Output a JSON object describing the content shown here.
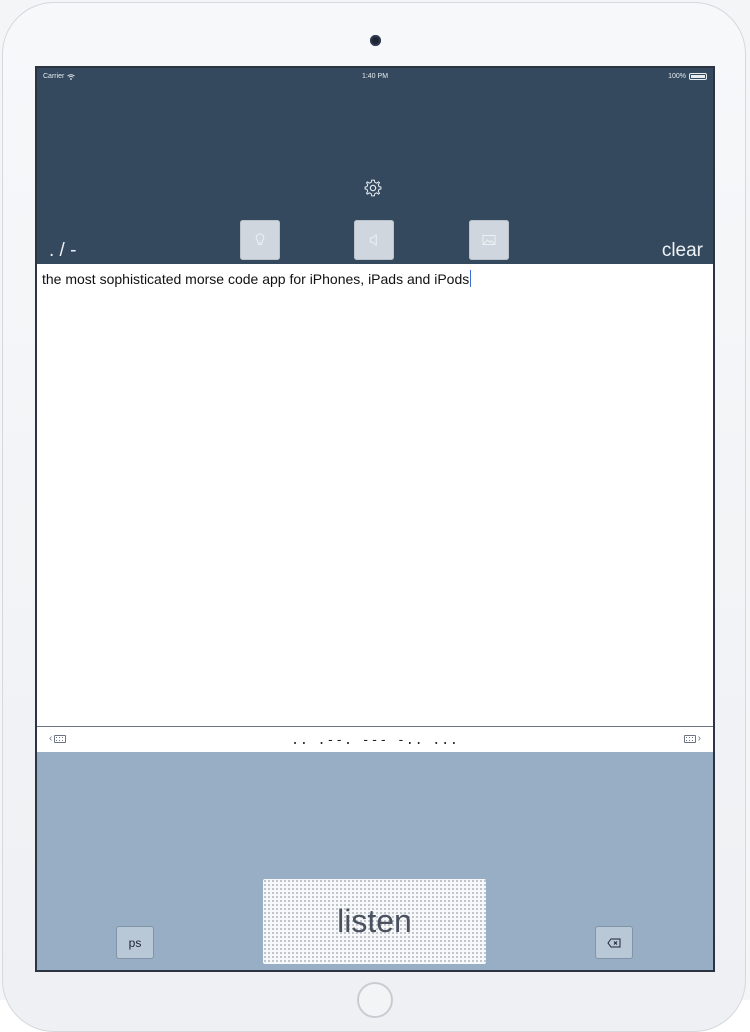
{
  "status_bar": {
    "carrier": "Carrier",
    "time": "1:40 PM",
    "battery": "100%"
  },
  "header": {
    "mode_label": ". / -",
    "clear_label": "clear",
    "icons": {
      "settings": "gear-icon",
      "flash": "lightbulb-icon",
      "sound": "speaker-icon",
      "share": "image-icon"
    }
  },
  "text_area": {
    "text": "the most sophisticated morse code app for iPhones, iPads and iPods"
  },
  "morse_strip": {
    "left_arrow": "‹",
    "right_arrow": "›",
    "code": ".. .--. --- -.. ..."
  },
  "input_panel": {
    "ps_label": "ps",
    "listen_label": "listen"
  },
  "colors": {
    "header": "#34495e",
    "panel": "#98aec4",
    "caret": "#3b6fd6"
  }
}
